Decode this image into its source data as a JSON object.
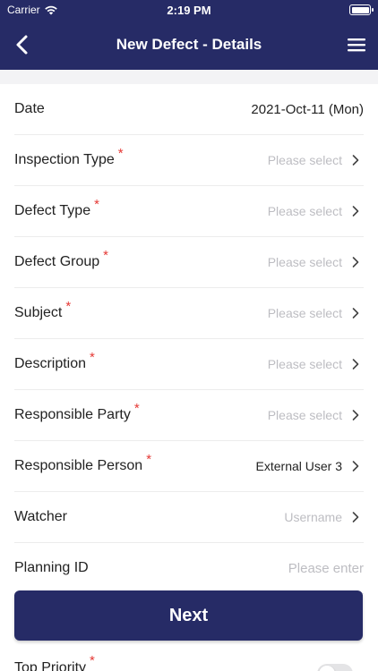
{
  "statusbar": {
    "carrier": "Carrier",
    "time": "2:19 PM"
  },
  "header": {
    "title": "New Defect - Details"
  },
  "form": {
    "rows": [
      {
        "label": "Date",
        "value": "2021-Oct-11 (Mon)",
        "required": false,
        "placeholder": false
      },
      {
        "label": "Inspection Type",
        "value": "Please select",
        "required": true,
        "placeholder": true
      },
      {
        "label": "Defect Type",
        "value": "Please select",
        "required": true,
        "placeholder": true
      },
      {
        "label": "Defect Group",
        "value": "Please select",
        "required": true,
        "placeholder": true
      },
      {
        "label": "Subject",
        "value": "Please select",
        "required": true,
        "placeholder": true
      },
      {
        "label": "Description",
        "value": "Please select",
        "required": true,
        "placeholder": true
      },
      {
        "label": "Responsible Party",
        "value": "Please select",
        "required": true,
        "placeholder": true
      },
      {
        "label": "Responsible Person",
        "value": "External User 3",
        "required": true,
        "placeholder": false
      },
      {
        "label": "Watcher",
        "value": "Username",
        "required": false,
        "placeholder": true
      },
      {
        "label": "Planning ID",
        "value": "Please enter",
        "required": false,
        "placeholder": true
      }
    ],
    "required_mark": "*",
    "top_priority_label": "Top Priority",
    "top_priority_on": false
  },
  "actions": {
    "next_label": "Next"
  },
  "colors": {
    "brand": "#262b66",
    "required": "#e53935",
    "placeholder": "#bdbdc2"
  }
}
